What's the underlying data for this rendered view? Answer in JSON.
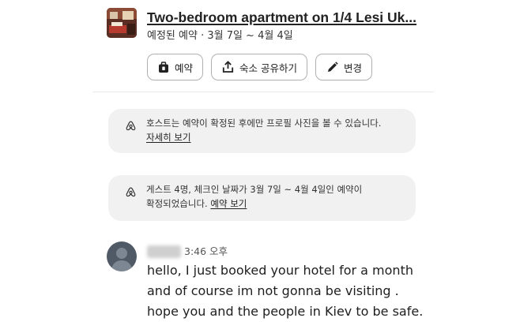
{
  "listing": {
    "title": "Two-bedroom apartment on 1/4 Lesi Uk...",
    "subtitle": "예정된 예약 · 3월 7일 ~ 4월 4일"
  },
  "actions": {
    "reservation_label": "예약",
    "share_label": "숙소 공유하기",
    "change_label": "변경"
  },
  "notices": [
    {
      "text": "호스트는 예약이 확정된 후에만 프로필 사진을 볼 수 있습니다.",
      "link": "자세히 보기"
    },
    {
      "text_line1": "게스트 4명, 체크인 날짜가 3월 7일 ~ 4월 4일인 예약이",
      "text_line2": "확정되었습니다.",
      "link": "예약 보기"
    }
  ],
  "message": {
    "time": "3:46 오후",
    "lines": [
      "hello, I just booked your hotel for a month",
      "and of course im not gonna be visiting .",
      "hope you and the people in Kiev to be safe."
    ]
  },
  "icons": {
    "reservation": "suitcase-icon",
    "share": "share-icon",
    "change": "pencil-icon",
    "notice": "airbnb-logo-icon"
  },
  "colors": {
    "text": "#222222",
    "card_bg": "#f1f1f1",
    "button_border": "#b0b0b0",
    "avatar": "#505a66"
  }
}
